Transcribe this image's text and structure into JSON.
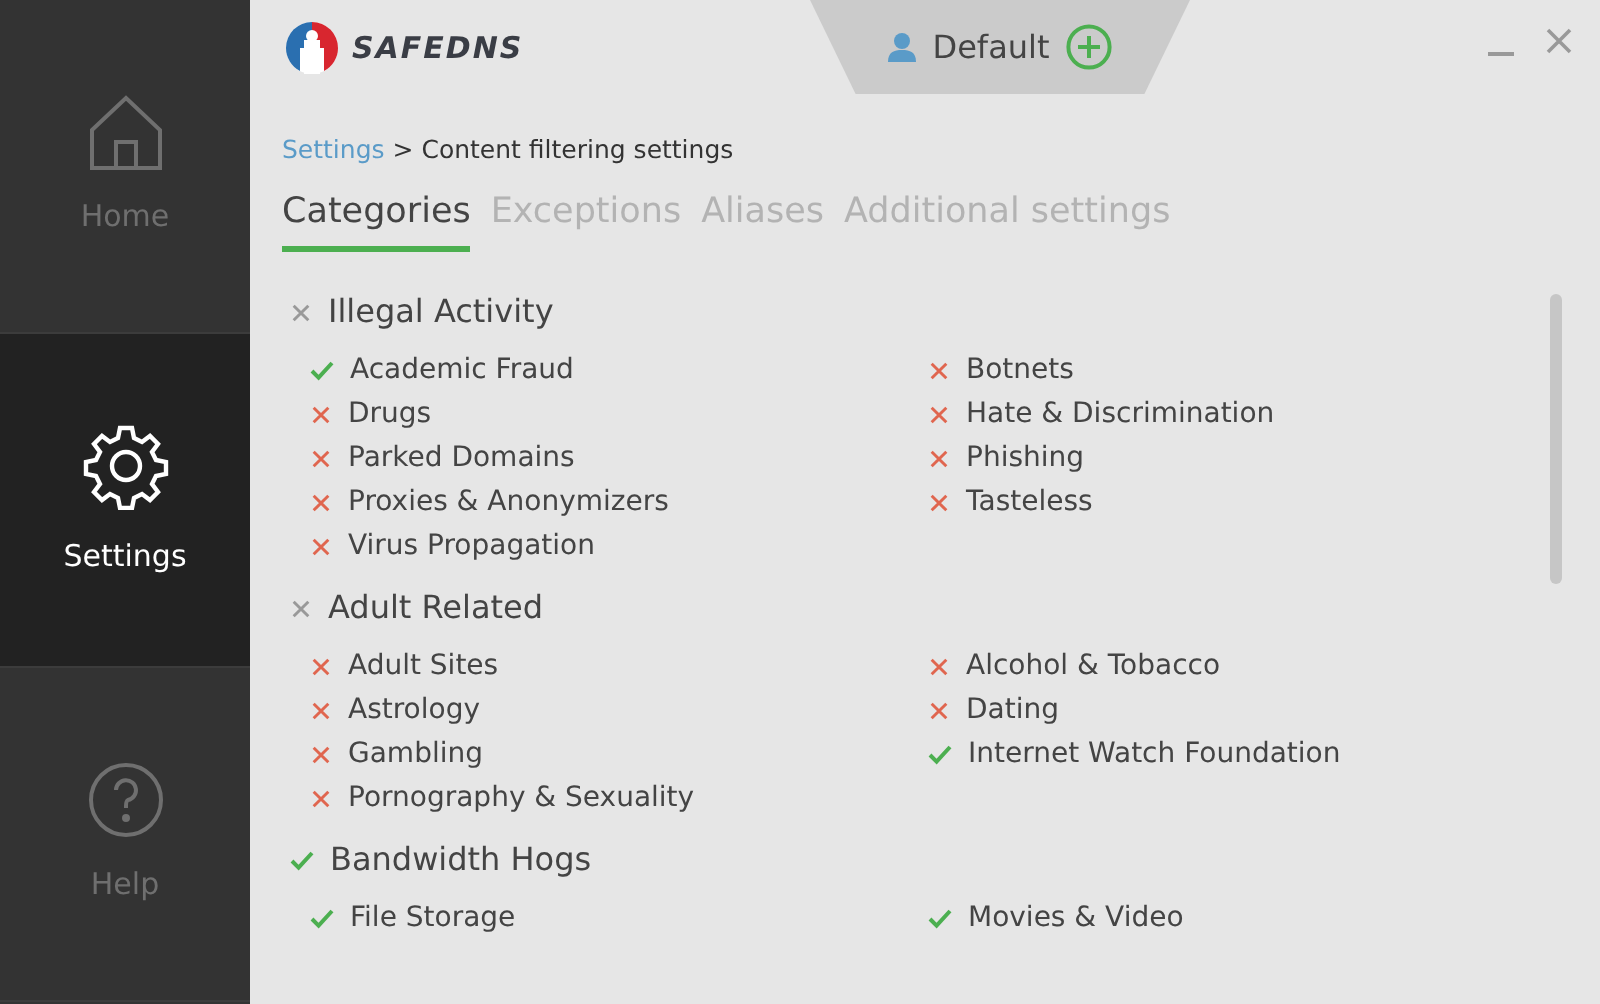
{
  "sidebar": {
    "items": [
      {
        "label": "Home",
        "kind": "home",
        "selected": false
      },
      {
        "label": "Settings",
        "kind": "gear",
        "selected": true
      },
      {
        "label": "Help",
        "kind": "help",
        "selected": false
      }
    ]
  },
  "header": {
    "logo": "SAFEDNS",
    "profile": "Default"
  },
  "breadcrumb": {
    "link": "Settings",
    "separator": ">",
    "current": "Content filtering settings"
  },
  "tabs": [
    {
      "label": "Categories",
      "selected": true
    },
    {
      "label": "Exceptions",
      "selected": false
    },
    {
      "label": "Aliases",
      "selected": false
    },
    {
      "label": "Additional settings",
      "selected": false
    }
  ],
  "groups": [
    {
      "title": "Illegal Activity",
      "allowed": false,
      "items": [
        {
          "label": "Academic Fraud",
          "allowed": true
        },
        {
          "label": "Botnets",
          "allowed": false
        },
        {
          "label": "Drugs",
          "allowed": false
        },
        {
          "label": "Hate & Discrimination",
          "allowed": false
        },
        {
          "label": "Parked Domains",
          "allowed": false
        },
        {
          "label": "Phishing",
          "allowed": false
        },
        {
          "label": "Proxies & Anonymizers",
          "allowed": false
        },
        {
          "label": "Tasteless",
          "allowed": false
        },
        {
          "label": "Virus Propagation",
          "allowed": false
        }
      ]
    },
    {
      "title": "Adult Related",
      "allowed": false,
      "items": [
        {
          "label": "Adult Sites",
          "allowed": false
        },
        {
          "label": "Alcohol & Tobacco",
          "allowed": false
        },
        {
          "label": "Astrology",
          "allowed": false
        },
        {
          "label": "Dating",
          "allowed": false
        },
        {
          "label": "Gambling",
          "allowed": false
        },
        {
          "label": "Internet Watch Foundation",
          "allowed": true
        },
        {
          "label": "Pornography & Sexuality",
          "allowed": false
        }
      ]
    },
    {
      "title": "Bandwidth Hogs",
      "allowed": true,
      "items": [
        {
          "label": "File Storage",
          "allowed": true
        },
        {
          "label": "Movies & Video",
          "allowed": true
        }
      ]
    }
  ]
}
